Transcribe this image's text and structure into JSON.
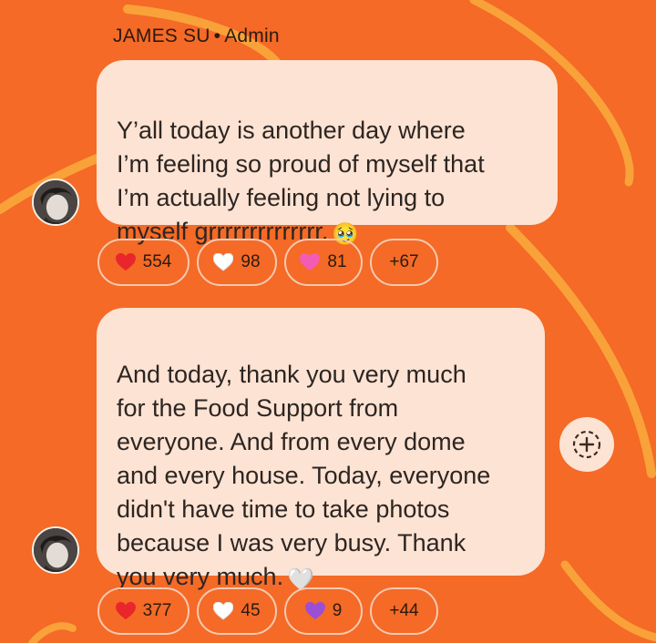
{
  "header": {
    "sender_name": "JAMES SU",
    "separator": "•",
    "role": "Admin"
  },
  "messages": [
    {
      "text": "Y’all today is another day where\nI’m feeling so proud of myself that\nI’m actually feeling not lying to\nmyself grrrrrrrrrrrrrr.",
      "emoji": "🥹",
      "reactions": [
        {
          "icon": "red-heart-icon",
          "color": "#e8262b",
          "count": "554"
        },
        {
          "icon": "white-heart-icon",
          "color": "#ffffff",
          "count": "98"
        },
        {
          "icon": "pink-heart-icon",
          "color": "#f45bb5",
          "count": "81"
        }
      ],
      "more": "+67"
    },
    {
      "text": "And today, thank you very much\nfor the Food Support from\neveryone. And from every dome\nand every house. Today, everyone\ndidn't have time to take photos\nbecause I was very busy. Thank\nyou very much.",
      "emoji": "🤍",
      "reactions": [
        {
          "icon": "red-heart-icon",
          "color": "#e8262b",
          "count": "377"
        },
        {
          "icon": "white-heart-icon",
          "color": "#ffffff",
          "count": "45"
        },
        {
          "icon": "purple-heart-icon",
          "color": "#9b4fd6",
          "count": "9"
        }
      ],
      "more": "+44"
    }
  ],
  "colors": {
    "background": "#f46a26",
    "bubble": "#fde3d3",
    "swirl": "#f9a23a"
  },
  "add_reaction_icon": "add-reaction-icon"
}
